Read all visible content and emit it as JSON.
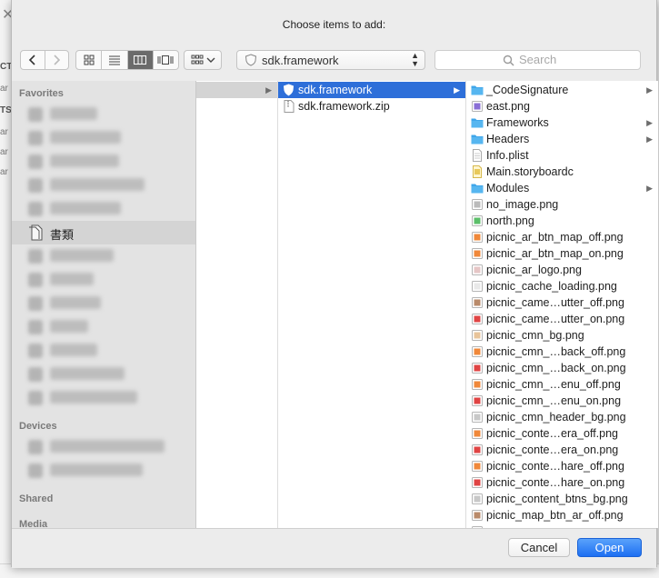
{
  "background_app": {
    "close_glyph": "✕",
    "fragments": [
      "CT",
      "ar",
      "TS",
      "ar",
      "ar",
      "ar"
    ]
  },
  "dialog": {
    "title": "Choose items to add:"
  },
  "toolbar": {
    "back": "‹",
    "forward": "›",
    "view_modes": [
      "icon-view",
      "list-view",
      "column-view",
      "coverflow-view"
    ],
    "active_view": "column-view",
    "arrange_icon": "arrange-grid-icon",
    "path": "sdk.framework",
    "search_placeholder": "Search"
  },
  "sidebar": {
    "sections": [
      {
        "title": "Favorites",
        "items": [
          {
            "label": "",
            "blurred": true
          },
          {
            "label": "",
            "blurred": true
          },
          {
            "label": "",
            "blurred": true
          },
          {
            "label": "",
            "blurred": true
          },
          {
            "label": "",
            "blurred": true
          },
          {
            "label": "",
            "blurred": true
          },
          {
            "label": "書類",
            "blurred": false,
            "selected": true
          },
          {
            "label": "",
            "blurred": true
          },
          {
            "label": "",
            "blurred": true
          },
          {
            "label": "",
            "blurred": true
          },
          {
            "label": "",
            "blurred": true
          },
          {
            "label": "",
            "blurred": true
          },
          {
            "label": "",
            "blurred": true
          },
          {
            "label": "",
            "blurred": true
          }
        ]
      },
      {
        "title": "Devices",
        "items": [
          {
            "label": "",
            "blurred": true
          },
          {
            "label": "",
            "blurred": true
          }
        ]
      },
      {
        "title": "Shared",
        "items": []
      },
      {
        "title": "Media",
        "items": []
      }
    ]
  },
  "columns": {
    "col1": [
      {
        "label": "",
        "state": "inactive-selected",
        "has_children": true
      }
    ],
    "col2": [
      {
        "label": "sdk.framework",
        "icon": "framework-icon",
        "state": "selected",
        "has_children": true
      },
      {
        "label": "sdk.framework.zip",
        "icon": "zip-icon",
        "state": "",
        "has_children": false
      }
    ],
    "col3": [
      {
        "label": "_CodeSignature",
        "icon": "folder",
        "has_children": true
      },
      {
        "label": "east.png",
        "icon": "png-purple",
        "has_children": false
      },
      {
        "label": "Frameworks",
        "icon": "folder",
        "has_children": true
      },
      {
        "label": "Headers",
        "icon": "folder",
        "has_children": true
      },
      {
        "label": "Info.plist",
        "icon": "doc",
        "has_children": false
      },
      {
        "label": "Main.storyboardc",
        "icon": "storyboard",
        "has_children": false
      },
      {
        "label": "Modules",
        "icon": "folder",
        "has_children": true
      },
      {
        "label": "no_image.png",
        "icon": "png-gray",
        "has_children": false
      },
      {
        "label": "north.png",
        "icon": "png-green",
        "has_children": false
      },
      {
        "label": "picnic_ar_btn_map_off.png",
        "icon": "png-orange",
        "has_children": false
      },
      {
        "label": "picnic_ar_btn_map_on.png",
        "icon": "png-orange",
        "has_children": false
      },
      {
        "label": "picnic_ar_logo.png",
        "icon": "png-light",
        "has_children": false
      },
      {
        "label": "picnic_cache_loading.png",
        "icon": "png-white",
        "has_children": false
      },
      {
        "label": "picnic_came…utter_off.png",
        "icon": "png-brown",
        "has_children": false
      },
      {
        "label": "picnic_came…utter_on.png",
        "icon": "png-red",
        "has_children": false
      },
      {
        "label": "picnic_cmn_bg.png",
        "icon": "png-tan",
        "has_children": false
      },
      {
        "label": "picnic_cmn_…back_off.png",
        "icon": "png-orange",
        "has_children": false
      },
      {
        "label": "picnic_cmn_…back_on.png",
        "icon": "png-red",
        "has_children": false
      },
      {
        "label": "picnic_cmn_…enu_off.png",
        "icon": "png-orange",
        "has_children": false
      },
      {
        "label": "picnic_cmn_…enu_on.png",
        "icon": "png-red",
        "has_children": false
      },
      {
        "label": "picnic_cmn_header_bg.png",
        "icon": "png-line",
        "has_children": false
      },
      {
        "label": "picnic_conte…era_off.png",
        "icon": "png-orange",
        "has_children": false
      },
      {
        "label": "picnic_conte…era_on.png",
        "icon": "png-red",
        "has_children": false
      },
      {
        "label": "picnic_conte…hare_off.png",
        "icon": "png-orange",
        "has_children": false
      },
      {
        "label": "picnic_conte…hare_on.png",
        "icon": "png-red",
        "has_children": false
      },
      {
        "label": "picnic_content_btns_bg.png",
        "icon": "png-line",
        "has_children": false
      },
      {
        "label": "picnic_map_btn_ar_off.png",
        "icon": "png-brown",
        "has_children": false
      },
      {
        "label": "",
        "icon": "png-white",
        "has_children": false
      }
    ]
  },
  "buttons": {
    "cancel": "Cancel",
    "open": "Open"
  },
  "colors": {
    "selection": "#2e6fd9",
    "folder": "#3fa6ea",
    "primary_button": "#1d6ff2"
  }
}
